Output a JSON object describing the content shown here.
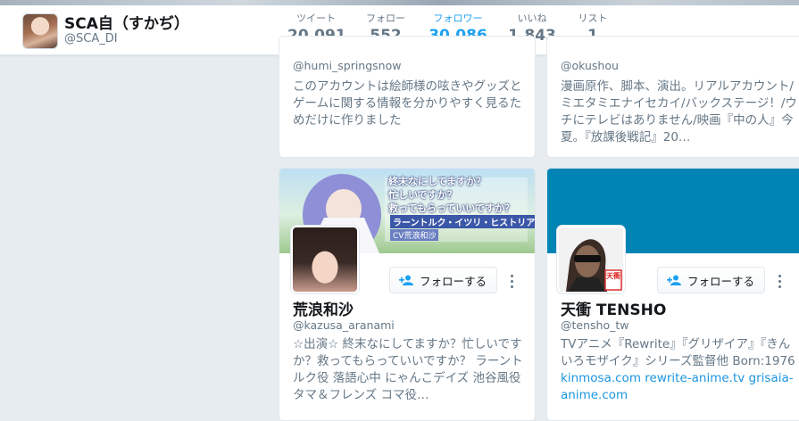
{
  "header": {
    "display_name": "SCA自（すかぢ）",
    "handle": "@SCA_DI",
    "stats": [
      {
        "label": "ツイート",
        "value": "20,091"
      },
      {
        "label": "フォロー",
        "value": "552"
      },
      {
        "label": "フォロワー",
        "value": "30,086"
      },
      {
        "label": "いいね",
        "value": "1,843"
      },
      {
        "label": "リスト",
        "value": "1"
      }
    ],
    "active_stat": "フォロワー"
  },
  "cards": {
    "humi": {
      "handle": "@humi_springsnow",
      "bio": "このアカウントは絵師様の呟きやグッズとゲームに関する情報を分かりやすく見るためだけに作りました"
    },
    "okushou": {
      "handle": "@okushou",
      "bio": "漫画原作、脚本、演出。リアルアカウント/ ミエタミエナイセカイ/バックステージ！/ウチにテレビはありません/映画『中の人』今夏。『放課後戦記』20…"
    },
    "kazusa": {
      "name": "荒浪和沙",
      "handle": "@kazusa_aranami",
      "bio": "☆出演☆ 終末なにしてますか？忙しいですか？救ってもらっていいですか？ ラーントルク役 落語心中 にゃんこデイズ 池谷風役 タマ＆フレンズ コマ役…",
      "follow_label": "フォローする",
      "banner_text_lines": [
        "終末なにしてますか？",
        "忙しいですか？",
        "救ってもらっていいですか？",
        "ラーントルク・イツリ・ヒストリア",
        "CV荒浪和沙"
      ]
    },
    "tensho": {
      "name": "天衝 TENSHO",
      "handle": "@tensho_tw",
      "bio_text": "TVアニメ『Rewrite』『グリザイア』『きんいろモザイク』シリーズ監督他 Born:1976 ",
      "bio_links": [
        "kinmosa.com",
        "rewrite-anime.tv",
        "grisaia-anime.com"
      ],
      "follow_label": "フォローする",
      "avatar_seal": "天衝"
    }
  },
  "colors": {
    "accent": "#1da1f2",
    "banner_blue": "#0084b4",
    "background": "#e6ecf0"
  }
}
